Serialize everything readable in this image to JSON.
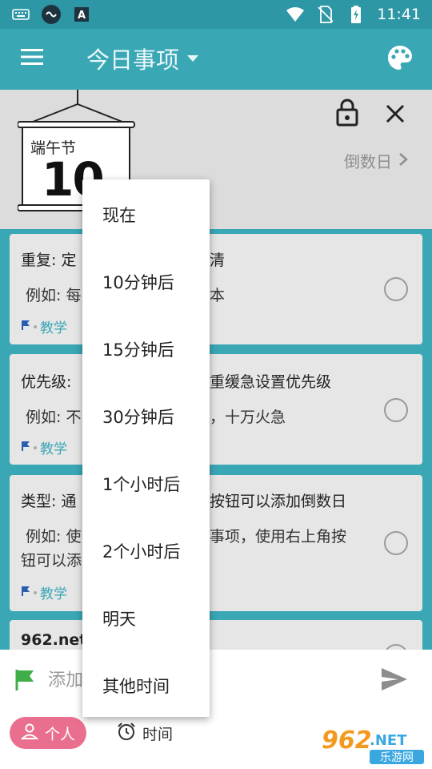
{
  "status_bar": {
    "time": "11:41",
    "icons": [
      "keyboard-icon",
      "link-icon",
      "font-a-icon",
      "wifi-icon",
      "no-sim-icon",
      "battery-charging-icon"
    ]
  },
  "app_bar": {
    "title": "今日事项",
    "icons": [
      "menu-icon",
      "dropdown-arrow-icon",
      "palette-icon"
    ]
  },
  "header": {
    "festival_name": "端午节",
    "festival_days": "10",
    "countdown_label": "倒数日",
    "icons": [
      "lock-icon",
      "close-icon",
      "chevron-right-icon"
    ]
  },
  "cards": [
    {
      "title": "重复: 定",
      "title_tail": "清",
      "example": "例如: 每",
      "example_tail": "本",
      "tag": "教学"
    },
    {
      "title": "优先级: ",
      "title_tail": "重缓急设置优先级",
      "example": "例如: 不",
      "example_tail": "，十万火急",
      "tag": "教学"
    },
    {
      "title": "类型: 通",
      "title_tail": "按钮可以添加倒数日",
      "example": "例如: 使",
      "example_tail": "事项，使用右上角按",
      "example_line2": "钮可以添",
      "tag": "教学"
    },
    {
      "title": "962.net"
    }
  ],
  "input_bar": {
    "placeholder": "添加",
    "person_label": "个人",
    "time_label": "时间",
    "icons": [
      "flag-icon",
      "send-icon",
      "person-icon",
      "alarm-icon"
    ]
  },
  "popup_menu": {
    "items": [
      "现在",
      "10分钟后",
      "15分钟后",
      "30分钟后",
      "1个小时后",
      "2个小时后",
      "明天",
      "其他时间"
    ]
  },
  "watermark": {
    "brand": "962",
    "suffix": ".NET",
    "subtitle": "乐游网"
  },
  "colors": {
    "primary": "#3aa7b5",
    "status_bar": "#2d97a5",
    "card_bg": "#e6e6e6",
    "header_bg": "#dcdcdc",
    "chip_pink": "#ea6f8e",
    "flag_green": "#3fae49"
  }
}
